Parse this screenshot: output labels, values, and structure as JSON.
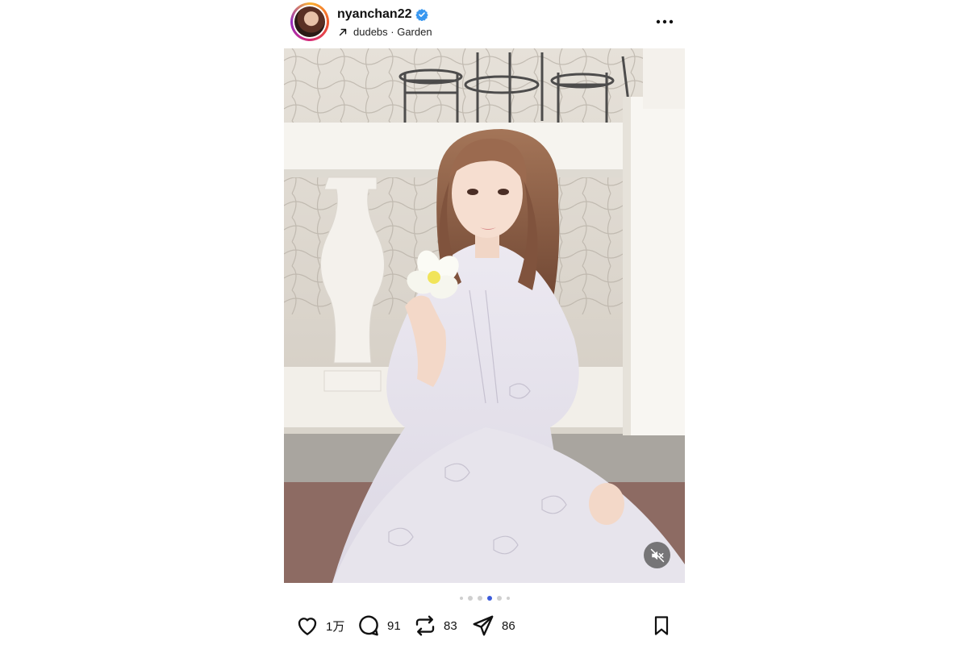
{
  "post": {
    "username": "nyanchan22",
    "verified": true,
    "subline": {
      "icon": "arrow-up-right-icon",
      "text": "dudebs · Garden"
    },
    "more_icon": "more-horizontal-icon",
    "media": {
      "type": "carousel",
      "description_icon": "photo",
      "mute_icon": "speaker-muted-icon",
      "pagination": {
        "total_visible": 6,
        "active_index": 3
      }
    },
    "actions": {
      "like": {
        "icon": "heart-icon",
        "count": "1万"
      },
      "comment": {
        "icon": "comment-bubble-icon",
        "count": "91"
      },
      "repost": {
        "icon": "repost-icon",
        "count": "83"
      },
      "share": {
        "icon": "send-icon",
        "count": "86"
      },
      "save": {
        "icon": "bookmark-icon"
      }
    },
    "colors": {
      "verified": "#3897f0",
      "active_dot": "#3b5bdb",
      "inactive_dot": "#cfcfcf"
    }
  }
}
